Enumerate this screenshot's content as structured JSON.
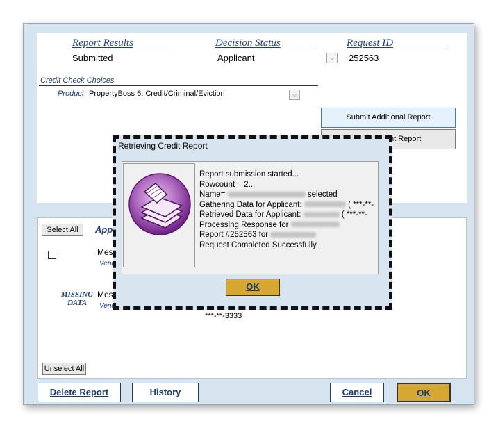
{
  "top": {
    "report_results": {
      "label": "Report Results",
      "value": "Submitted"
    },
    "decision_status": {
      "label": "Decision Status",
      "value": "Applicant"
    },
    "request_id": {
      "label": "Request ID",
      "value": "252563"
    },
    "credit_check_choices": "Credit Check Choices",
    "product_label": "Product",
    "product_value": "PropertyBoss 6. Credit/Criminal/Eviction",
    "submit_additional": "Submit Additional Report",
    "print_report_partial": "nt Report"
  },
  "lower": {
    "select_all": "Select All",
    "applicant_heading_partial": "App",
    "row1_text": "Mes",
    "row1_sub": "Vend",
    "missing_data": [
      "MISSING",
      "DATA"
    ],
    "row2_text": "Mes",
    "row2_sub": "Vend",
    "ssn_masked": "***-**-3333",
    "unselect_all": "Unselect All"
  },
  "footer": {
    "delete_report": "Delete Report",
    "history": "History",
    "cancel": "Cancel",
    "ok": "OK"
  },
  "dialog": {
    "title": "Retrieving Credit Report",
    "lines": {
      "l1": "Report submission started...",
      "l2": "Rowcount = 2...",
      "l3a": "Name=",
      "l3b": "selected",
      "l4a": "Gathering Data for Applicant:",
      "l4b": "( ***-**-",
      "l5a": "Retrieved Data for Applicant:",
      "l5b": "( ***-**-",
      "l6a": "Processing Response for",
      "l7a": "Report #252563 for",
      "l8": "Request Completed Successfully."
    },
    "ok": "OK",
    "icon": "printer-report-icon"
  },
  "colors": {
    "window_bg": "#d6e4f0",
    "header_blue": "#1a3c8c",
    "ok_gold": "#d6a832",
    "icon_purple": "#8e3ea0"
  }
}
